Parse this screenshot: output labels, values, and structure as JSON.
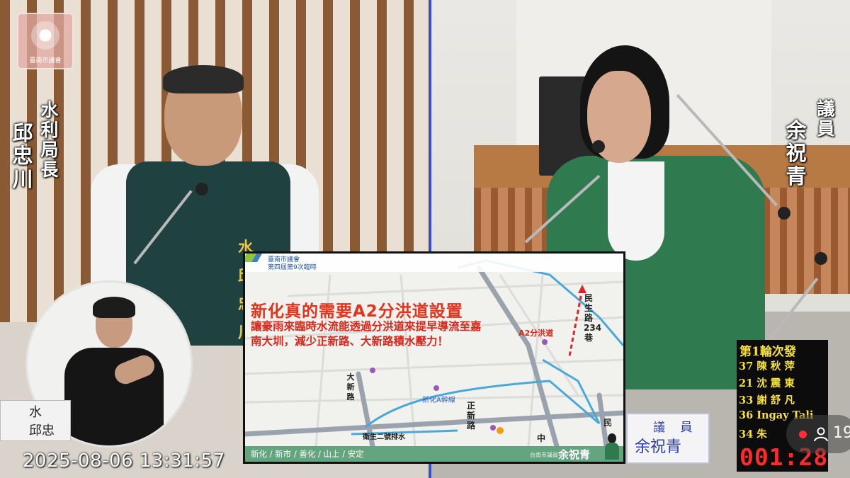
{
  "timestamp": "2025-08-06 13:31:57",
  "logo": {
    "text": "臺南市議會"
  },
  "left_caption": {
    "title_chars": [
      "水",
      "利",
      "局",
      "長"
    ],
    "name_chars": [
      "邱",
      "忠",
      "川"
    ]
  },
  "right_caption": {
    "title_chars": [
      "議",
      "員"
    ],
    "name_chars": [
      "余",
      "祝",
      "青"
    ]
  },
  "vest_name_chars": [
    "水",
    "邱",
    "忠",
    "川"
  ],
  "left_desk_plate": {
    "line1": "水",
    "line2": "邱忠"
  },
  "slide": {
    "council_line1": "臺南市議會",
    "council_line2": "第四屆第9次臨時",
    "title": "新化真的需要A2分洪道設置",
    "body": "讓豪雨來臨時水流能透過分洪道來提早導流至嘉南大圳，減少正新路、大新路積水壓力！",
    "map_labels": {
      "a2": "A2分洪道",
      "minsheng": "民生路234巷",
      "daxin": "大新路",
      "xinhua_a": "新化A幹線",
      "zhengxin": "正新路",
      "weisheng": "衛生二號排水",
      "zhong": "中",
      "min": "民"
    },
    "footer_text": "新化 / 新市 / 善化 / 山上 / 安定",
    "footer_org": "台南市議員",
    "footer_name": "余祝青",
    "colors": {
      "title": "#e5321c",
      "footer": "#64a57f",
      "water": "#4aa8d8",
      "a2_route": "#e02424"
    }
  },
  "nameplate": {
    "role": "議 員",
    "name": "余祝青"
  },
  "rotation": {
    "title": "第1輪次發",
    "speakers": [
      {
        "num": "37",
        "name": "陳 秋 萍"
      },
      {
        "num": "21",
        "name": "沈 震 東"
      },
      {
        "num": "33",
        "name": "謝 舒 凡"
      },
      {
        "num": "36",
        "name": "Ingay Tali"
      },
      {
        "num": "34",
        "name": "朱"
      }
    ],
    "timer": "001:28",
    "colors": {
      "text": "#f7e13a",
      "timer": "#ff2b2b"
    }
  },
  "live": {
    "viewer_count": "19",
    "icons": [
      "live-record-icon",
      "viewer-person-icon"
    ]
  }
}
